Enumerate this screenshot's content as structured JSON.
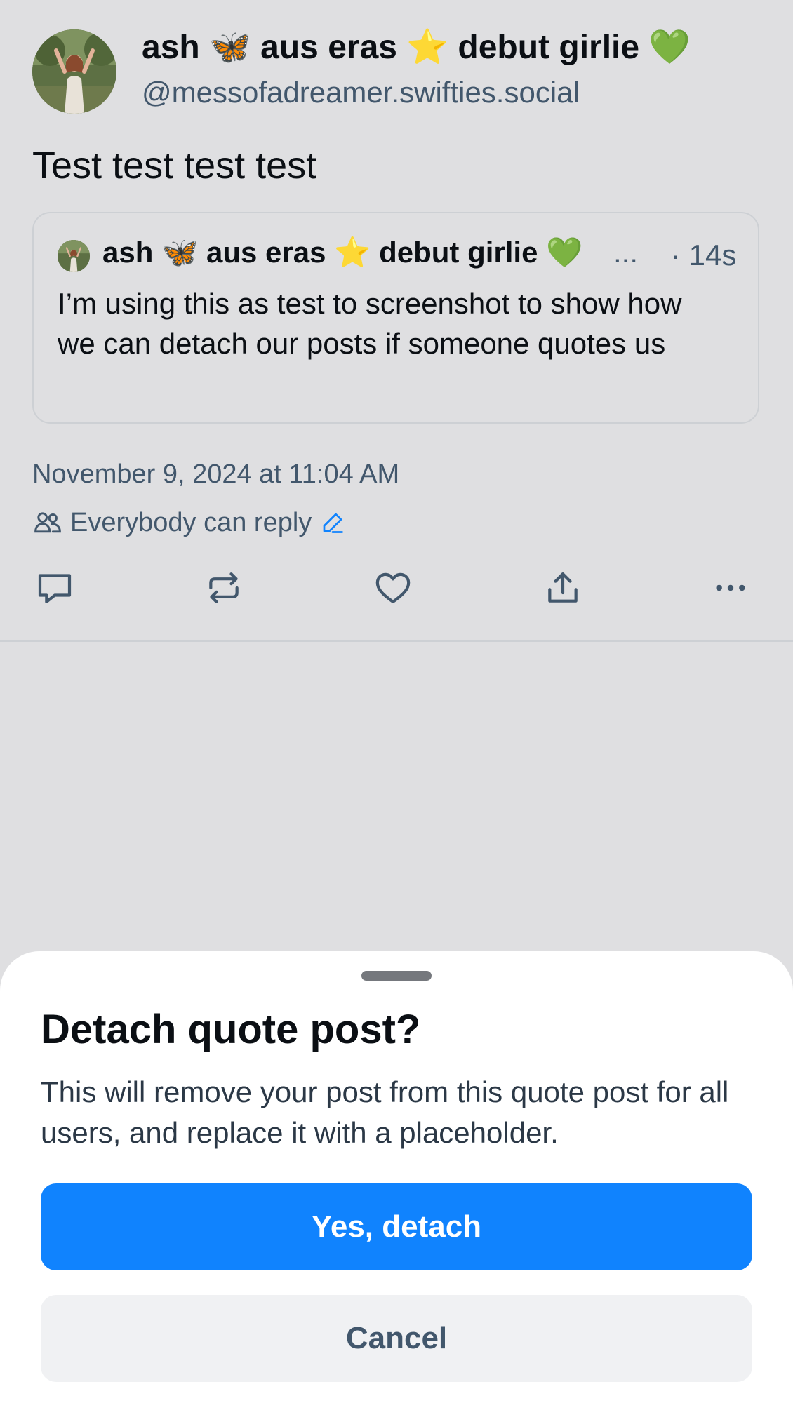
{
  "post": {
    "author_name": "ash 🦋 aus eras ⭐ debut girlie 💚",
    "author_handle": "@messofadreamer.swifties.social",
    "text": "Test test test test",
    "quote": {
      "author_name": "ash 🦋 aus eras ⭐ debut girlie 💚",
      "ellipsis": "...",
      "time": "· 14s",
      "text": "I’m using this as test to screenshot to show how we can detach our posts if someone quotes us"
    },
    "timestamp": "November 9, 2024 at 11:04 AM",
    "reply_setting": "Everybody can reply",
    "actions": [
      "reply-icon",
      "repost-icon",
      "heart-icon",
      "share-icon",
      "more-icon"
    ]
  },
  "sheet": {
    "title": "Detach quote post?",
    "description": "This will remove your post from this quote post for all users, and replace it with a placeholder.",
    "confirm_label": "Yes, detach",
    "cancel_label": "Cancel"
  },
  "colors": {
    "background_dim": "#dfdfe1",
    "primary_blue": "#1083fe",
    "muted_text": "#42576c",
    "sheet_bg": "#ffffff",
    "cancel_bg": "#f0f1f3"
  }
}
